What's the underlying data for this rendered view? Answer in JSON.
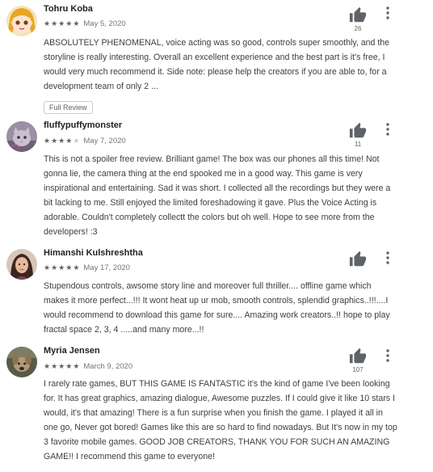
{
  "reviews": [
    {
      "name": "Tohru Koba",
      "rating": 5,
      "date": "May 5, 2020",
      "text": "ABSOLUTELY PHENOMENAL, voice acting was so good, controls super smoothly, and the\nstoryline is really interesting. Overall an excellent experience and the best part is it's free, I\nwould very much recommend it. Side note: please help the creators if you are able to, for a\ndevelopment team of only 2 ...",
      "helpful_count": "26",
      "full_review_label": "Full Review",
      "avatar": "anime-character-avatar"
    },
    {
      "name": "fluffypuffymonster",
      "rating": 4,
      "date": "May 7, 2020",
      "text": "This is not a spoiler free review. Brilliant game! The box was our phones all this time! Not\ngonna lie, the camera thing at the end spooked me in a good way. This game is very\ninspirational and entertaining. Sad it was short. I collected all the recordings but they were a\nbit lacking to me. Still enjoyed the limited foreshadowing it gave. Plus the Voice Acting is\nadorable. Couldn't completely collectt the colors but oh well. Hope to see more from the\ndevelopers! :3",
      "helpful_count": "11",
      "avatar": "cat-photo-avatar"
    },
    {
      "name": "Himanshi Kulshreshtha",
      "rating": 5,
      "date": "May 17, 2020",
      "text": "Stupendous controls, awsome story line and moreover full thriller.... offline game which\nmakes it more perfect...!!! It wont heat up ur mob, smooth controls, splendid graphics..!!!....I\nwould recommend to download this game for sure.... Amazing work creators..!! hope to play\nfractal space 2, 3, 4 .....and many more...!!",
      "helpful_count": "",
      "avatar": "woman-photo-avatar"
    },
    {
      "name": "Myria Jensen",
      "rating": 5,
      "date": "March 9, 2020",
      "text": "I rarely rate games, BUT THIS GAME IS FANTASTIC it's the kind of game I've been looking\nfor. It has great graphics, amazing dialogue, Awesome puzzles. If I could give it like 10 stars I\nwould, it's that amazing! There is a fun surprise when you finish the game. I played it all in\none go, Never got bored! Games like this are so hard to find nowadays. But It's now in my top\n3 favorite mobile games. GOOD JOB CREATORS, THANK YOU FOR SUCH AN AMAZING\nGAME!! I recommend this game to everyone!",
      "helpful_count": "107",
      "avatar": "dog-photo-avatar"
    }
  ],
  "colors": {
    "star_on": "#5f6368",
    "star_off": "#c8c8c8",
    "icon": "#5f6368"
  },
  "icons": {
    "helpful": "thumbs-up-icon",
    "menu": "more-vert-icon",
    "star": "star-icon"
  }
}
